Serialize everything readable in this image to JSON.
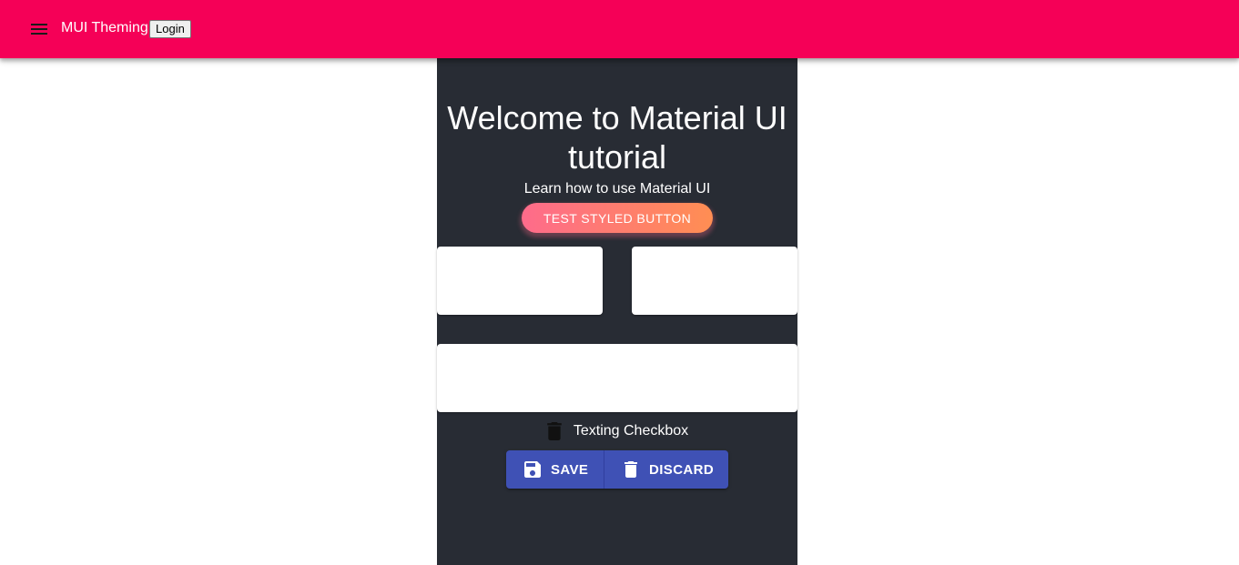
{
  "appbar": {
    "title": "MUI Theming",
    "login_label": "Login",
    "background_color": "#f50057",
    "menu_icon": "menu-icon"
  },
  "main": {
    "background_color": "#282c34",
    "headline": "Welcome to Material UI tutorial",
    "subtitle": "Learn how to use Material UI",
    "styled_button_label": "TEST STYLED BUTTON",
    "checkbox": {
      "icon": "trash-icon",
      "label": "Texting Checkbox"
    },
    "button_group": {
      "save_label": "SAVE",
      "save_icon": "save-icon",
      "discard_label": "DISCARD",
      "discard_icon": "delete-icon",
      "color": "#3f51b5"
    }
  }
}
